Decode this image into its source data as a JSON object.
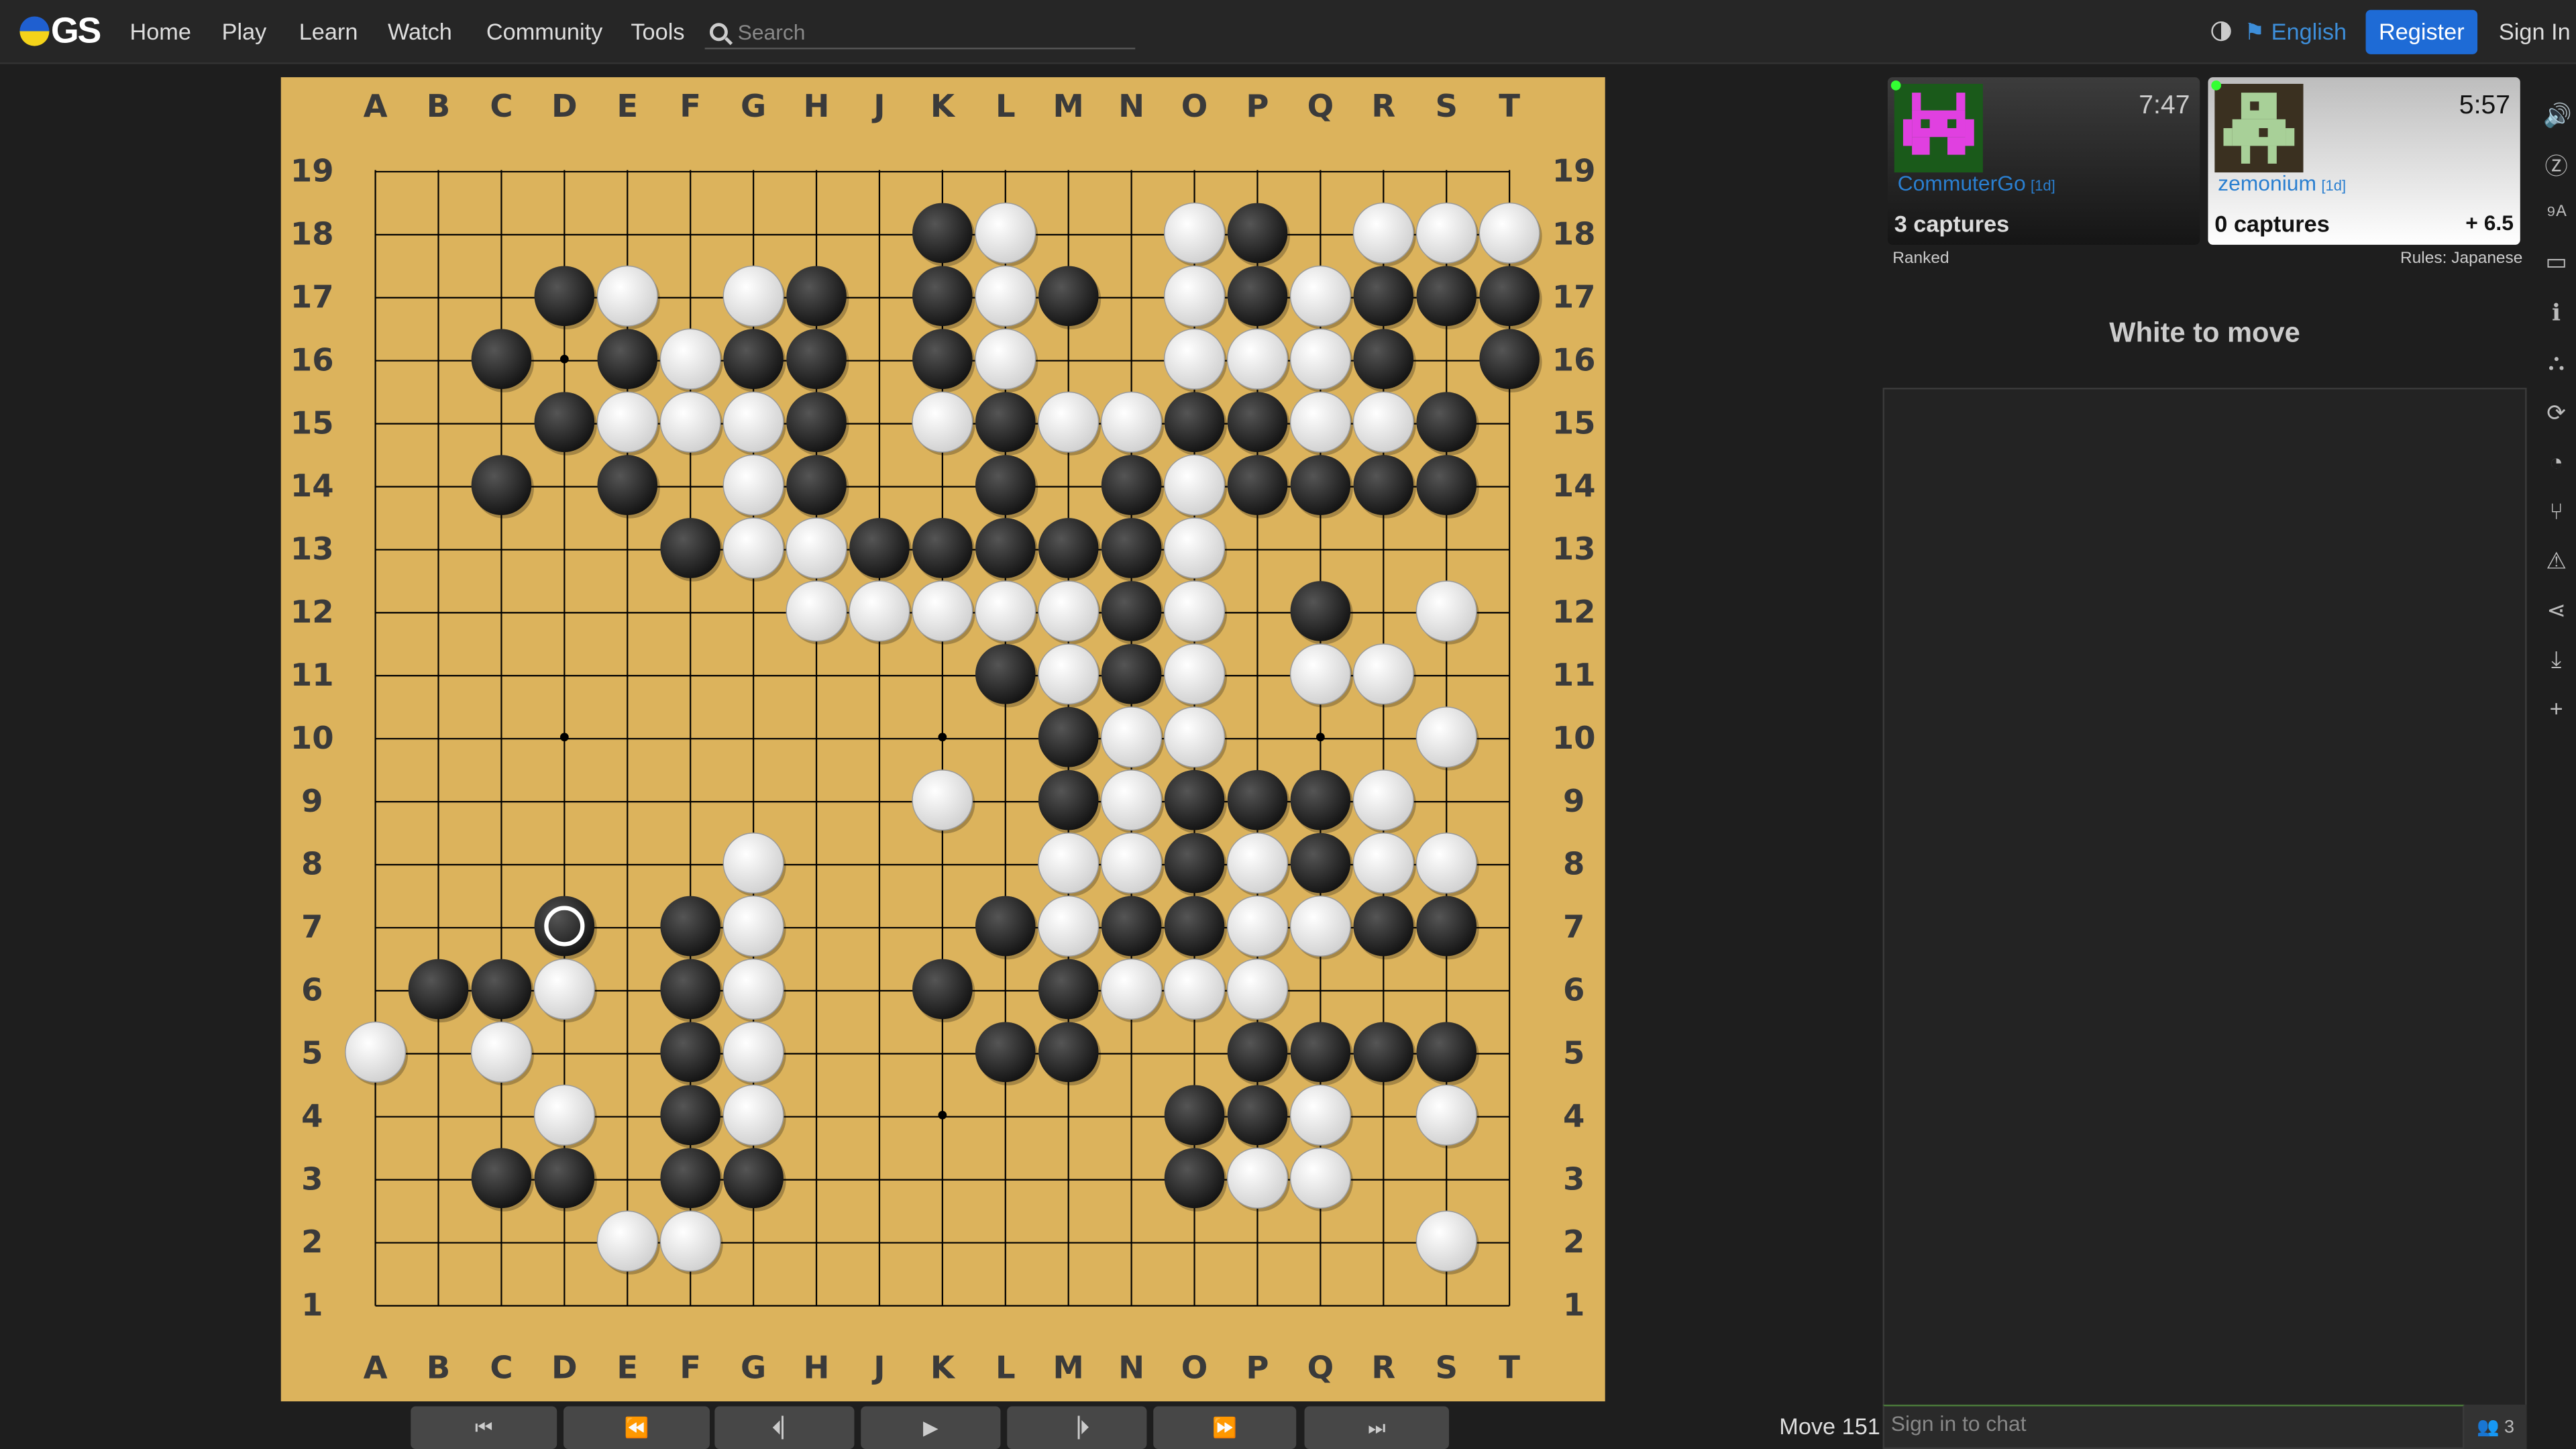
{
  "nav": {
    "logo_text": "GS",
    "links": [
      "Home",
      "Play",
      "Learn",
      "Watch",
      "Community",
      "Tools"
    ],
    "search_placeholder": "Search",
    "language": "English",
    "register": "Register",
    "sign_in": "Sign In"
  },
  "board": {
    "size": 19,
    "columns": [
      "A",
      "B",
      "C",
      "D",
      "E",
      "F",
      "G",
      "H",
      "J",
      "K",
      "L",
      "M",
      "N",
      "O",
      "P",
      "Q",
      "R",
      "S",
      "T"
    ],
    "rows": [
      "19",
      "18",
      "17",
      "16",
      "15",
      "14",
      "13",
      "12",
      "11",
      "10",
      "9",
      "8",
      "7",
      "6",
      "5",
      "4",
      "3",
      "2",
      "1"
    ],
    "hoshi": [
      "D16",
      "K16",
      "Q16",
      "D10",
      "K10",
      "Q10",
      "D4",
      "K4",
      "Q4"
    ],
    "black": [
      "K18",
      "P18",
      "D17",
      "H17",
      "K17",
      "M17",
      "P17",
      "R17",
      "S17",
      "T17",
      "C16",
      "E16",
      "G16",
      "H16",
      "K16",
      "R16",
      "T16",
      "D15",
      "H15",
      "L15",
      "O15",
      "P15",
      "S15",
      "C14",
      "E14",
      "H14",
      "L14",
      "N14",
      "P14",
      "Q14",
      "R14",
      "S14",
      "F13",
      "J13",
      "K13",
      "L13",
      "M13",
      "N13",
      "N12",
      "Q12",
      "L11",
      "N11",
      "M10",
      "M9",
      "O9",
      "P9",
      "Q9",
      "O8",
      "Q8",
      "D7",
      "F7",
      "L7",
      "N7",
      "O7",
      "R7",
      "S7",
      "B6",
      "C6",
      "F6",
      "K6",
      "M6",
      "F5",
      "L5",
      "M5",
      "P5",
      "Q5",
      "R5",
      "S5",
      "F4",
      "O4",
      "P4",
      "C3",
      "D3",
      "F3",
      "G3",
      "O3"
    ],
    "white": [
      "L18",
      "O18",
      "R18",
      "S18",
      "T18",
      "E17",
      "G17",
      "L17",
      "O17",
      "Q17",
      "F16",
      "L16",
      "O16",
      "P16",
      "Q16",
      "E15",
      "F15",
      "G15",
      "K15",
      "M15",
      "N15",
      "Q15",
      "R15",
      "G14",
      "O14",
      "G13",
      "H13",
      "O13",
      "H12",
      "J12",
      "K12",
      "L12",
      "M12",
      "O12",
      "S12",
      "M11",
      "O11",
      "Q11",
      "R11",
      "N10",
      "O10",
      "S10",
      "K9",
      "N9",
      "R9",
      "G8",
      "M8",
      "N8",
      "P8",
      "R8",
      "S8",
      "G7",
      "M7",
      "P7",
      "Q7",
      "D6",
      "G6",
      "N6",
      "O6",
      "P6",
      "A5",
      "C5",
      "G5",
      "D4",
      "G4",
      "Q4",
      "S4",
      "P3",
      "Q3",
      "E2",
      "F2",
      "S2"
    ],
    "last_move": "D7"
  },
  "controls": {
    "move_label": "Move 151"
  },
  "players": {
    "black": {
      "name": "CommuterGo",
      "rank": "[1d]",
      "clock": "7:47",
      "captures": "3 captures"
    },
    "white": {
      "name": "zemonium",
      "rank": "[1d]",
      "clock": "5:57",
      "captures": "0 captures",
      "komi": "+ 6.5"
    }
  },
  "game_meta": {
    "ranked": "Ranked",
    "rules": "Rules: Japanese"
  },
  "status": "White to move",
  "chat": {
    "placeholder": "Sign in to chat",
    "users": "3"
  },
  "right_icons": [
    "speaker-icon",
    "zen-mode-icon",
    "coordinates-icon",
    "presentation-icon",
    "info-icon",
    "tree-icon",
    "refresh-icon",
    "speed-icon",
    "branch-icon",
    "warning-icon",
    "share-icon",
    "download-icon",
    "plus-icon"
  ],
  "colors": {
    "board": "#dcb35c",
    "accent": "#1e6bd6",
    "link": "#2a7fd0"
  }
}
